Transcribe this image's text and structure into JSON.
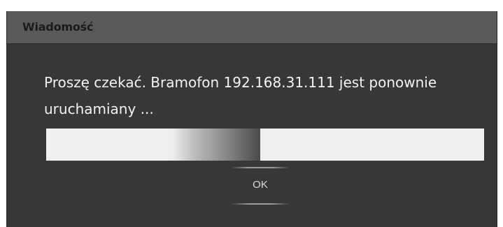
{
  "dialog": {
    "title": "Wiadomość",
    "message": "Proszę czekać. Bramofon 192.168.31.111 jest ponownie uruchamiany ...",
    "progress": {
      "state": "indeterminate"
    },
    "ok_label": "OK"
  },
  "colors": {
    "dialog_background": "#373737",
    "titlebar_background": "#5a5a5a",
    "progress_track": "#efefef",
    "text": "#f3f3f3"
  }
}
